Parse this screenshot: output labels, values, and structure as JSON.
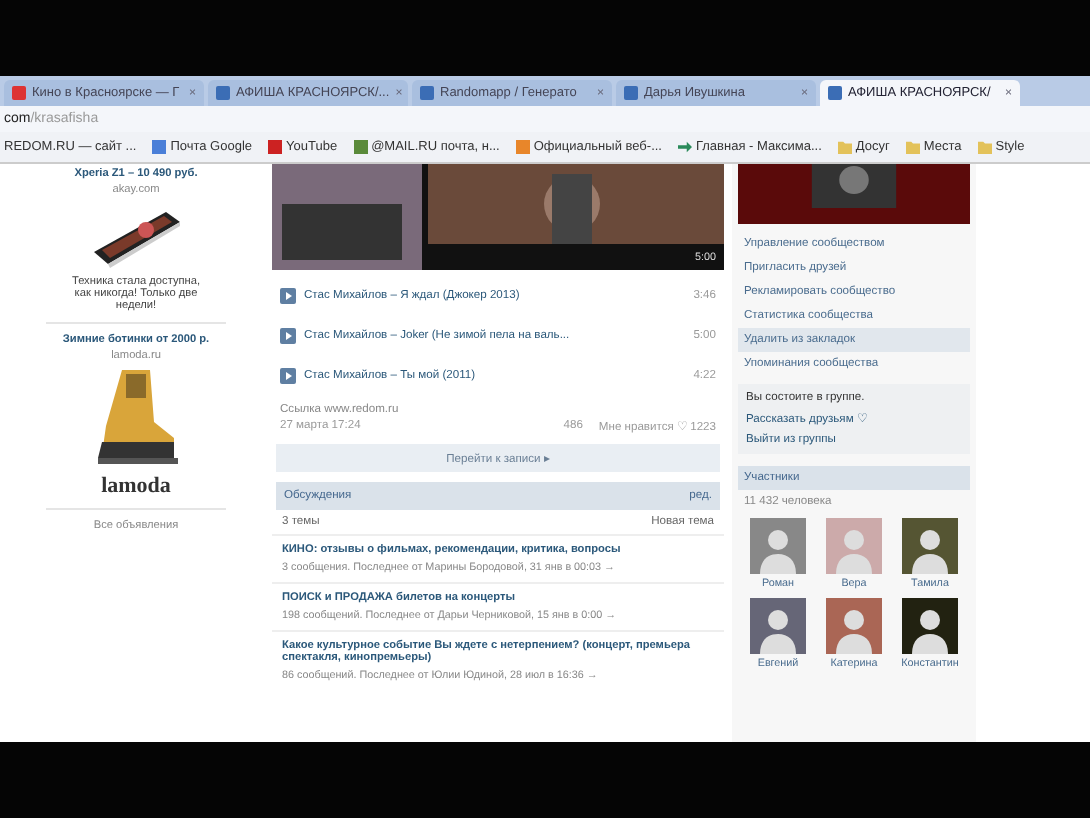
{
  "tabs": [
    {
      "label": "Кино в Красноярске — Г",
      "close": "×",
      "selected": false,
      "kind": "red"
    },
    {
      "label": "АФИША КРАСНОЯРСК/...",
      "close": "×",
      "selected": false,
      "kind": "blue"
    },
    {
      "label": "Randomapp / Генерато",
      "close": "×",
      "selected": false,
      "kind": "blue"
    },
    {
      "label": "Дарья Ивушкина",
      "close": "×",
      "selected": false,
      "kind": "blue"
    },
    {
      "label": "АФИША КРАСНОЯРСК/",
      "close": "×",
      "selected": true,
      "kind": "blue"
    }
  ],
  "address": {
    "host": "com",
    "path": "/krasafisha"
  },
  "bookmarks": [
    {
      "label": "REDOM.RU — сайт ...",
      "kind": "none"
    },
    {
      "label": "Почта Google",
      "kind": "blue"
    },
    {
      "label": "YouTube",
      "kind": "red"
    },
    {
      "label": "@MAIL.RU почта, н...",
      "kind": "green"
    },
    {
      "label": "Официальный веб-...",
      "kind": "orange"
    },
    {
      "label": "Главная - Максима...",
      "kind": "arrow"
    },
    {
      "label": "Досуг",
      "kind": "folder"
    },
    {
      "label": "Места",
      "kind": "folder"
    },
    {
      "label": "Style",
      "kind": "folder"
    }
  ],
  "ads": [
    {
      "title": "Xperia Z1 – 10 490 руб.",
      "domain": "akay.com",
      "kind": "phone",
      "text": "Техника стала доступна, как никогда! Только две недели!"
    },
    {
      "title": "Зимние ботинки от 2000 р.",
      "domain": "lamoda.ru",
      "kind": "boot",
      "text": "lamoda"
    }
  ],
  "ads_link": "Все объявления",
  "post": {
    "video_duration": "5:00",
    "tracks": [
      {
        "title": "Стас Михайлов – Я ждал (Джокер 2013)",
        "duration": "3:46"
      },
      {
        "title": "Стас Михайлов – Joker (Не зимой пела на валь...",
        "duration": "5:00"
      },
      {
        "title": "Стас Михайлов – Ты мой (2011)",
        "duration": "4:22"
      }
    ],
    "link": "Ссылка www.redom.ru",
    "date": "27 марта 17:24",
    "reposts": "486",
    "likes": "Мне нравится ♡ 1223",
    "button": "Перейти к записи ▸"
  },
  "discussions": {
    "title": "Обсуждения",
    "edit": "ред.",
    "count": "3 темы",
    "new": "Новая тема",
    "topics": [
      {
        "title": "КИНО: отзывы о фильмах, рекомендации, критика, вопросы",
        "meta": "3 сообщения. Последнее от Марины Бородовой, 31 янв в 00:03 →"
      },
      {
        "title": "ПОИСК и ПРОДАЖА билетов на концерты",
        "meta": "198 сообщений. Последнее от Дарьи Черниковой, 15 янв в 0:00 →"
      },
      {
        "title": "Какое культурное событие Вы ждете с нетерпением? (концерт, премьера спектакля, кинопремьеры)",
        "meta": "86 сообщений. Последнее от Юлии Юдиной, 28 июл в 16:36 →"
      }
    ]
  },
  "menu": [
    {
      "label": "Управление сообществом",
      "selected": false
    },
    {
      "label": "Пригласить друзей",
      "selected": false
    },
    {
      "label": "Рекламировать сообщество",
      "selected": false
    },
    {
      "label": "Статистика сообщества",
      "selected": false
    },
    {
      "label": "Удалить из закладок",
      "selected": true
    },
    {
      "label": "Упоминания сообщества",
      "selected": false
    }
  ],
  "membership": {
    "status": "Вы состоите в группе.",
    "share": "Рассказать друзьям ♡",
    "leave": "Выйти из группы"
  },
  "members": {
    "title": "Участники",
    "count": "11 432 человека",
    "people": [
      {
        "name": "Роман"
      },
      {
        "name": "Вера"
      },
      {
        "name": "Тамила"
      },
      {
        "name": "Евгений"
      },
      {
        "name": "Катерина"
      },
      {
        "name": "Константин"
      }
    ]
  }
}
